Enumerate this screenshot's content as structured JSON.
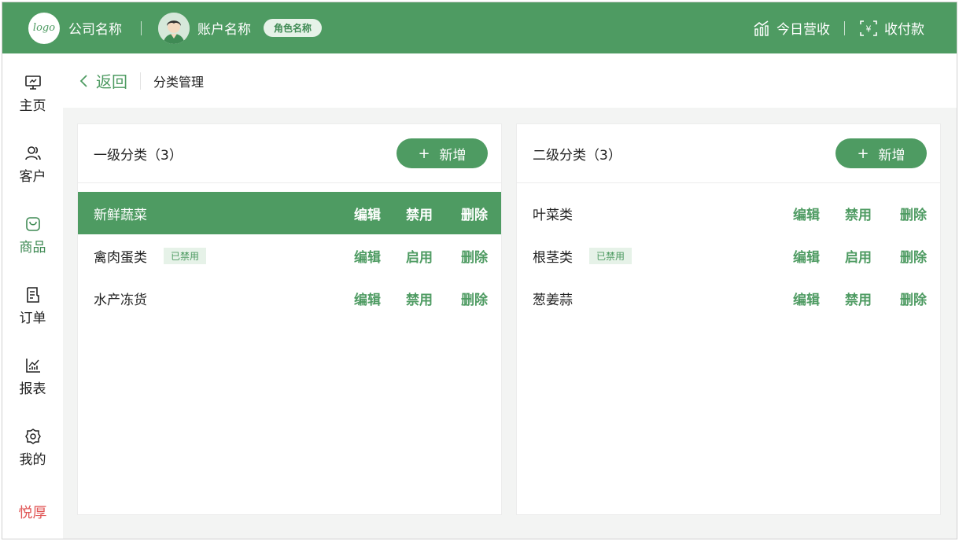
{
  "topbar": {
    "logo_text": "logo",
    "company": "公司名称",
    "account": "账户名称",
    "role": "角色名称",
    "revenue": "今日营收",
    "payment": "收付款"
  },
  "sidebar": {
    "items": [
      {
        "label": "主页",
        "icon": "monitor-icon"
      },
      {
        "label": "客户",
        "icon": "users-icon"
      },
      {
        "label": "商品",
        "icon": "shopping-bag-icon",
        "active": true
      },
      {
        "label": "订单",
        "icon": "document-icon"
      },
      {
        "label": "报表",
        "icon": "chart-icon"
      },
      {
        "label": "我的",
        "icon": "settings-icon"
      }
    ],
    "brand": "悦厚"
  },
  "subheader": {
    "back_label": "返回",
    "title": "分类管理"
  },
  "panels": {
    "left": {
      "title": "一级分类（3）",
      "add_label": "新增",
      "rows": [
        {
          "name": "新鲜蔬菜",
          "badge": "",
          "edit": "编辑",
          "toggle": "禁用",
          "delete": "删除",
          "selected": true
        },
        {
          "name": "禽肉蛋类",
          "badge": "已禁用",
          "edit": "编辑",
          "toggle": "启用",
          "delete": "删除"
        },
        {
          "name": "水产冻货",
          "badge": "",
          "edit": "编辑",
          "toggle": "禁用",
          "delete": "删除"
        }
      ]
    },
    "right": {
      "title": "二级分类（3）",
      "add_label": "新增",
      "rows": [
        {
          "name": "叶菜类",
          "badge": "",
          "edit": "编辑",
          "toggle": "禁用",
          "delete": "删除"
        },
        {
          "name": "根茎类",
          "badge": "已禁用",
          "edit": "编辑",
          "toggle": "启用",
          "delete": "删除"
        },
        {
          "name": "葱姜蒜",
          "badge": "",
          "edit": "编辑",
          "toggle": "禁用",
          "delete": "删除"
        }
      ]
    }
  },
  "colors": {
    "primary": "#4e9b62",
    "badge_bg": "#e6f2e8",
    "brand_red": "#e05555"
  }
}
